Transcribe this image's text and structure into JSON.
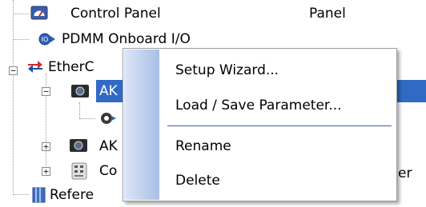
{
  "tree": {
    "items": [
      {
        "label": "Control Panel",
        "icon": "gauge-icon"
      },
      {
        "label": "PDMM Onboard I/O",
        "icon": "io-link-icon"
      },
      {
        "label": "EtherC",
        "icon": "ethercat-icon"
      },
      {
        "label": "AK",
        "icon": "drive-icon"
      },
      {
        "label": "",
        "icon": "gear-cable-icon"
      },
      {
        "label": "AK",
        "icon": "drive-icon"
      },
      {
        "label": "Co",
        "icon": "io-module-icon"
      },
      {
        "label": "Refere",
        "icon": "book-icon"
      }
    ],
    "column2": {
      "row0": "Panel",
      "row6_tail": "er"
    }
  },
  "context_menu": {
    "items": [
      {
        "label": "Setup Wizard..."
      },
      {
        "label": "Load / Save Parameter..."
      },
      {
        "label": "Rename"
      },
      {
        "label": "Delete"
      }
    ]
  },
  "colors": {
    "selection": "#316ac5",
    "menu_gutter": "#a9bfe6",
    "separator": "#3a5ea8"
  }
}
